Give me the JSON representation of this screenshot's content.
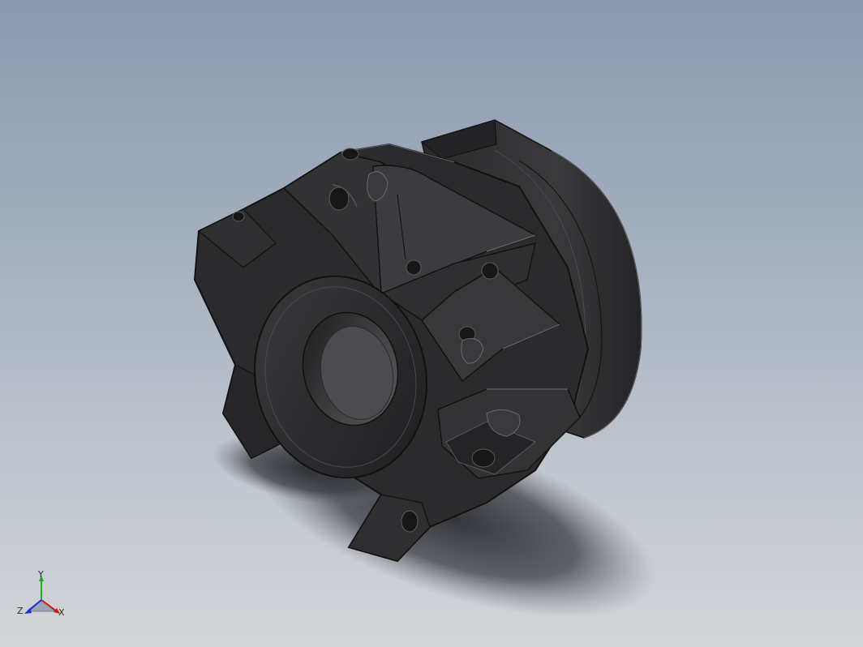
{
  "viewport": {
    "background_top": "#8a9ab0",
    "background_bottom": "#d2d4d8"
  },
  "model": {
    "object": "face-mill-cutter-body",
    "body_color": "#2b2b2d",
    "edge_color": "#111112",
    "highlight_color": "#5a5a5e",
    "shadow_color": "#3a3c42"
  },
  "triad": {
    "x_label": "X",
    "y_label": "Y",
    "z_label": "Z",
    "x_color": "#d01818",
    "y_color": "#18b018",
    "z_color": "#1830d0"
  }
}
